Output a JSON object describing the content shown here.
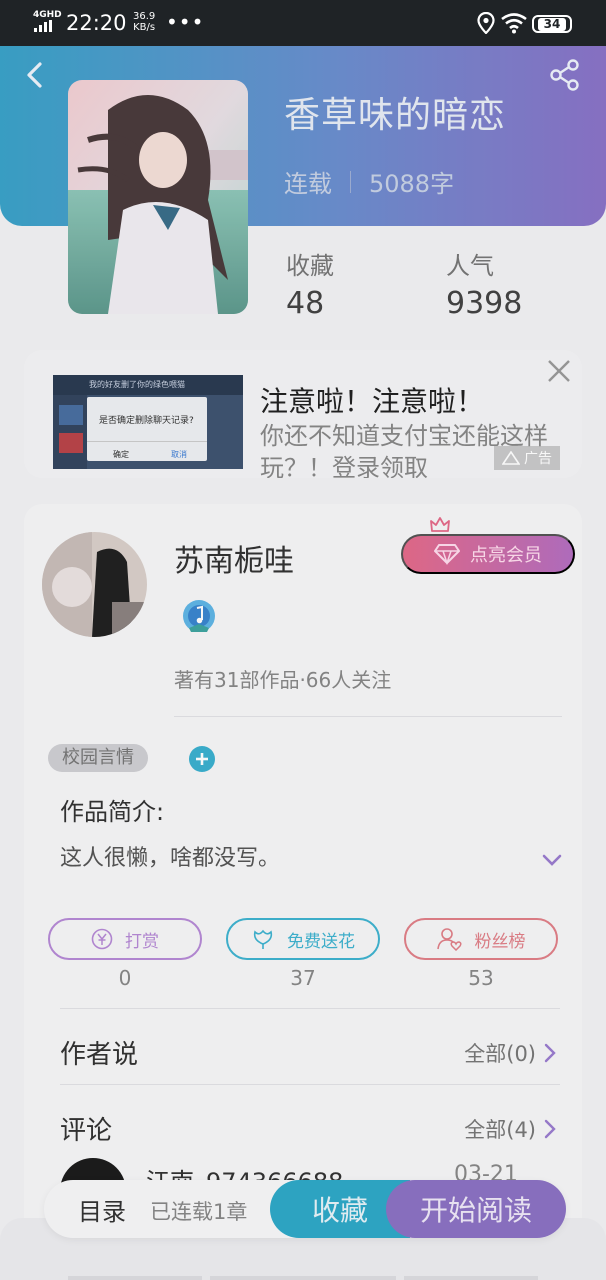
{
  "status_bar": {
    "network": "4GHD",
    "time": "22:20",
    "speed_value": "36.9",
    "speed_unit": "KB/s",
    "more": "•••",
    "battery": "34"
  },
  "book": {
    "title": "香草味的暗恋",
    "status": "连载",
    "word_count": "5088字",
    "stats": [
      {
        "label": "收藏",
        "value": "48"
      },
      {
        "label": "人气",
        "value": "9398"
      }
    ]
  },
  "ad": {
    "headline": "注意啦！注意啦！",
    "subtext": "你还不知道支付宝还能这样玩？！登录领取",
    "tag": "广告",
    "thumb_title": "我的好友删了你的绿色喂猫",
    "thumb_dialog": "是否确定删除聊天记录?",
    "thumb_confirm": "确定",
    "thumb_cancel": "取消"
  },
  "author": {
    "name": "苏南栀哇",
    "vip_label": "点亮会员",
    "stats_text": "著有31部作品·66人关注",
    "genre_tag": "校园言情",
    "intro_title": "作品简介:",
    "intro_text": "这人很懒，啥都没写。"
  },
  "actions": [
    {
      "label": "打赏",
      "count": "0",
      "color": "#b68ad6"
    },
    {
      "label": "免费送花",
      "count": "37",
      "color": "#3fb3d0"
    },
    {
      "label": "粉丝榜",
      "count": "53",
      "color": "#e07f88"
    }
  ],
  "sections": {
    "author_says": {
      "label": "作者说",
      "more": "全部(0)"
    },
    "comments": {
      "label": "评论",
      "more": "全部(4)"
    }
  },
  "comment_peek": {
    "user": "江南_974366688",
    "date": "03-21"
  },
  "bottom_bar": {
    "toc": "目录",
    "serial": "已连载1章",
    "favorite": "收藏",
    "start_reading": "开始阅读"
  },
  "colors": {
    "hero_start": "#3aa3c9",
    "hero_end": "#8b73c8",
    "favorite_btn": "#2fa9c8",
    "read_btn": "#8c72c4",
    "vip": "#e56b8a"
  }
}
